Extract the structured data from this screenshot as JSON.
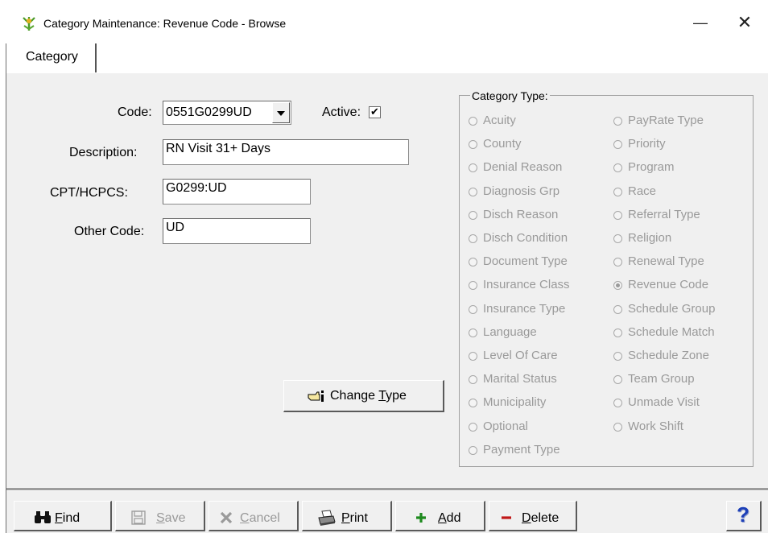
{
  "window": {
    "title": "Category Maintenance: Revenue Code - Browse",
    "minimize_glyph": "—",
    "close_glyph": "✕"
  },
  "tabs": [
    {
      "label": "Category"
    }
  ],
  "form": {
    "code_label": "Code:",
    "code_value": "0551G0299UD",
    "active_label": "Active:",
    "active_checked": true,
    "description_label": "Description:",
    "description_value": "RN Visit 31+ Days",
    "cpt_label": "CPT/HCPCS:",
    "cpt_value": "G0299:UD",
    "other_code_label": "Other Code:",
    "other_code_value": "UD",
    "change_type_button": {
      "pre": "Change ",
      "hotkey": "T",
      "post": "ype"
    }
  },
  "category_type": {
    "group_label": "Category Type:",
    "selected": "Revenue Code",
    "column1": [
      "Acuity",
      "County",
      "Denial Reason",
      "Diagnosis Grp",
      "Disch Reason",
      "Disch Condition",
      "Document Type",
      "Insurance Class",
      "Insurance Type",
      "Language",
      "Level Of Care",
      "Marital Status",
      "Municipality",
      "Optional",
      "Payment Type"
    ],
    "column2": [
      "PayRate Type",
      "Priority",
      "Program",
      "Race",
      "Referral Type",
      "Religion",
      "Renewal Type",
      "Revenue Code",
      "Schedule Group",
      "Schedule Match",
      "Schedule Zone",
      "Team Group",
      "Unmade Visit",
      "Work Shift"
    ]
  },
  "toolbar": {
    "find": {
      "hotkey": "F",
      "rest": "ind",
      "enabled": true,
      "icon": "binoculars-icon"
    },
    "save": {
      "hotkey": "S",
      "rest": "ave",
      "enabled": false,
      "icon": "floppy-icon"
    },
    "cancel": {
      "hotkey": "C",
      "rest": "ancel",
      "enabled": false,
      "icon": "x-icon"
    },
    "print": {
      "hotkey": "P",
      "rest": "rint",
      "enabled": true,
      "icon": "printer-icon"
    },
    "add": {
      "hotkey": "A",
      "rest": "dd",
      "enabled": true,
      "icon": "plus-icon"
    },
    "delete": {
      "hotkey": "D",
      "rest": "elete",
      "enabled": true,
      "icon": "minus-icon"
    },
    "help": {
      "glyph": "?",
      "icon": "help-icon"
    }
  },
  "colors": {
    "panel_bg": "#f0f0f0",
    "disabled_text": "#9a9a9a",
    "add_green": "#1e8a1e",
    "delete_red": "#c01818",
    "help_blue": "#1c3fb8"
  }
}
